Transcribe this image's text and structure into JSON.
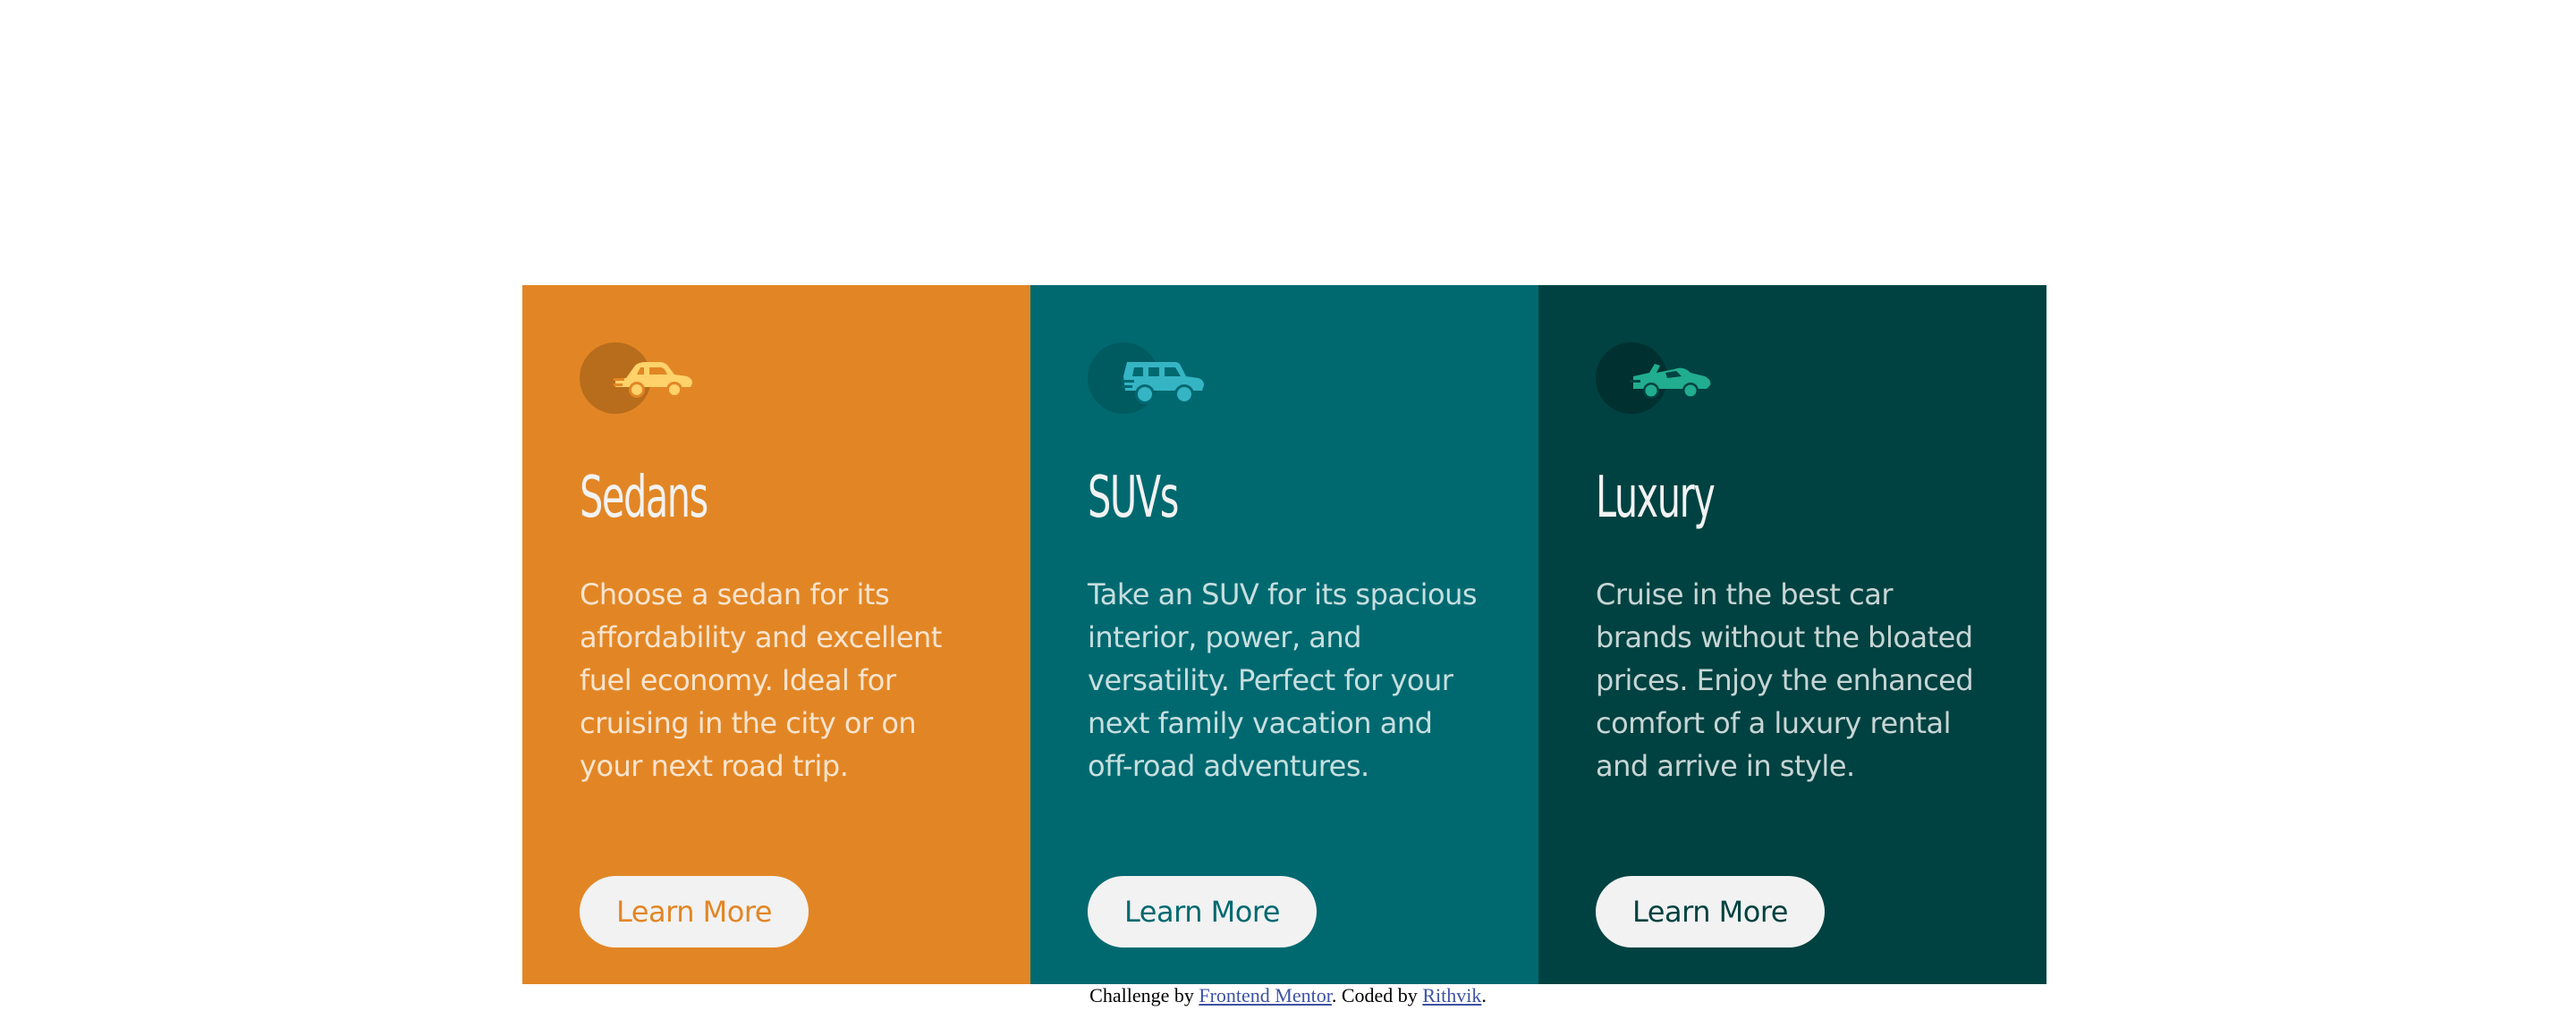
{
  "cards": [
    {
      "icon": "sedan-car-icon",
      "title": "Sedans",
      "description": "Choose a sedan for its affordability and excellent fuel economy. Ideal for cruising in the city or on your next road trip.",
      "button_label": "Learn More",
      "colors": {
        "background": "#e28625",
        "icon": "#ffd26a"
      }
    },
    {
      "icon": "suv-car-icon",
      "title": "SUVs",
      "description": "Take an SUV for its spacious interior, power, and versatility. Perfect for your next family vacation and off-road adventures.",
      "button_label": "Learn More",
      "colors": {
        "background": "#006970",
        "icon": "#35b5c4"
      }
    },
    {
      "icon": "luxury-car-icon",
      "title": "Luxury",
      "description": "Cruise in the best car brands without the bloated prices. Enjoy the enhanced comfort of a luxury rental and arrive in style.",
      "button_label": "Learn More",
      "colors": {
        "background": "#004241",
        "icon": "#21ad8f"
      }
    }
  ],
  "attribution": {
    "prefix": "Challenge by ",
    "link1": "Frontend Mentor",
    "middle": ". Coded by ",
    "link2": "Rithvik",
    "suffix": "."
  },
  "colors": {
    "button_background": "#f2f2f2",
    "heading_text": "#f2f2f2",
    "link": "#3e52a3"
  }
}
